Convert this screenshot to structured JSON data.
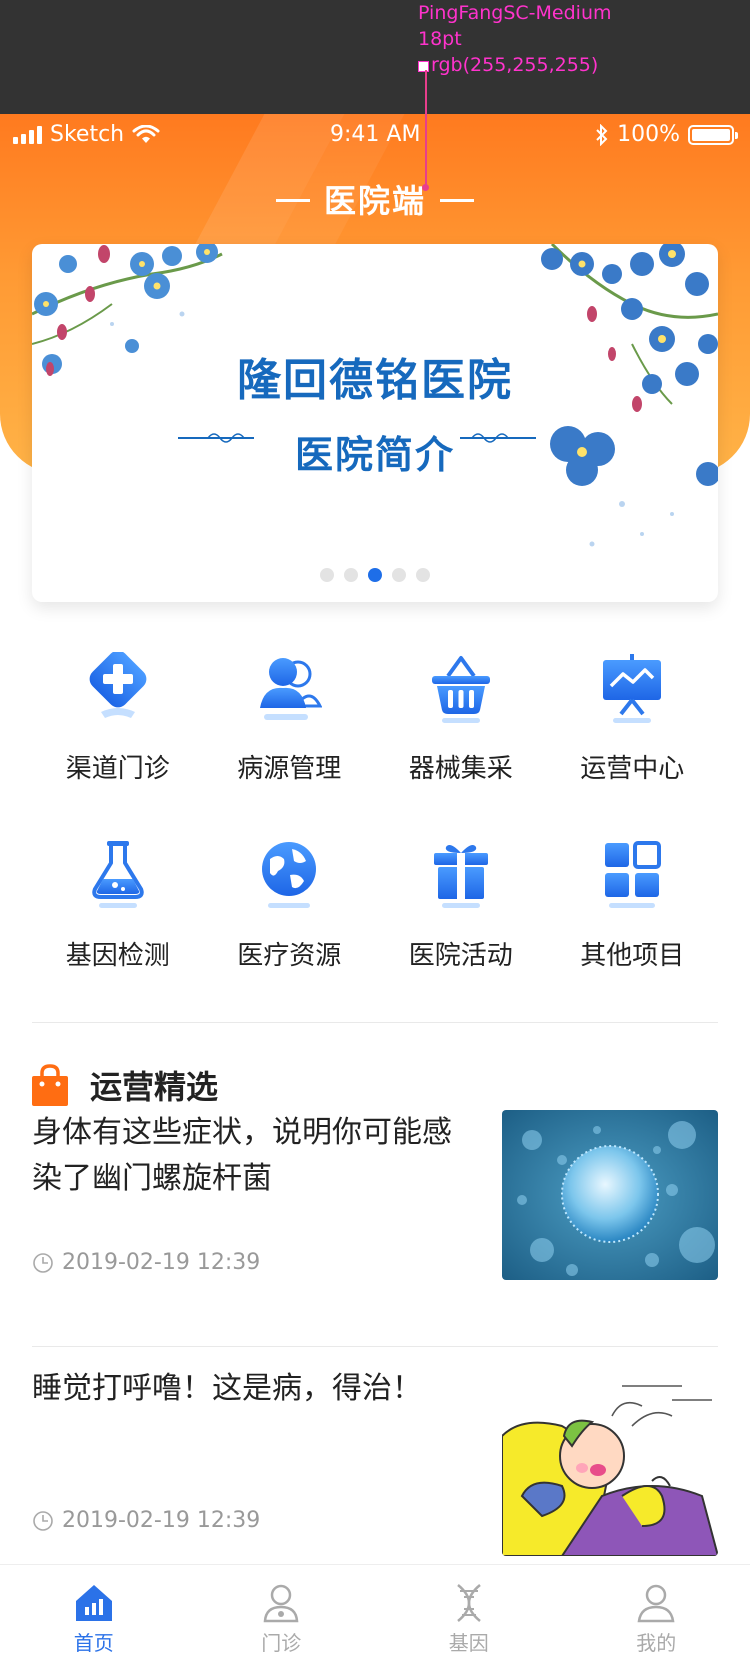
{
  "annotation": {
    "font": "PingFangSC-Medium",
    "size": "18pt",
    "color": "rgb(255,255,255)"
  },
  "status_bar": {
    "carrier": "Sketch",
    "time": "9:41 AM",
    "battery": "100%"
  },
  "header": {
    "title": "医院端"
  },
  "banner": {
    "line1": "隆回德铭医院",
    "line2": "医院简介",
    "pages": 5,
    "active_page": 3
  },
  "menu": {
    "items": [
      {
        "label": "渠道门诊",
        "icon": "medical-cross-icon"
      },
      {
        "label": "病源管理",
        "icon": "users-icon"
      },
      {
        "label": "器械集采",
        "icon": "basket-icon"
      },
      {
        "label": "运营中心",
        "icon": "presentation-board-icon"
      },
      {
        "label": "基因检测",
        "icon": "flask-icon"
      },
      {
        "label": "医疗资源",
        "icon": "globe-icon"
      },
      {
        "label": "医院活动",
        "icon": "gift-icon"
      },
      {
        "label": "其他项目",
        "icon": "grid-apps-icon"
      }
    ]
  },
  "section": {
    "title": "运营精选",
    "icon": "shopping-bag-icon"
  },
  "articles": [
    {
      "title": "身体有这些症状，说明你可能感染了幽门螺旋杆菌",
      "time": "2019-02-19 12:39",
      "thumb": "bacteria-illustration"
    },
    {
      "title": "睡觉打呼噜！这是病，得治！",
      "time": "2019-02-19 12:39",
      "thumb": "snoring-cartoon"
    }
  ],
  "tabbar": {
    "items": [
      {
        "label": "首页",
        "icon": "home-chart-icon",
        "active": true
      },
      {
        "label": "门诊",
        "icon": "doctor-icon",
        "active": false
      },
      {
        "label": "基因",
        "icon": "dna-icon",
        "active": false
      },
      {
        "label": "我的",
        "icon": "profile-icon",
        "active": false
      }
    ]
  },
  "colors": {
    "accent": "#ff7a1f",
    "primary_blue": "#2b72e8",
    "banner_text": "#1669bd"
  }
}
